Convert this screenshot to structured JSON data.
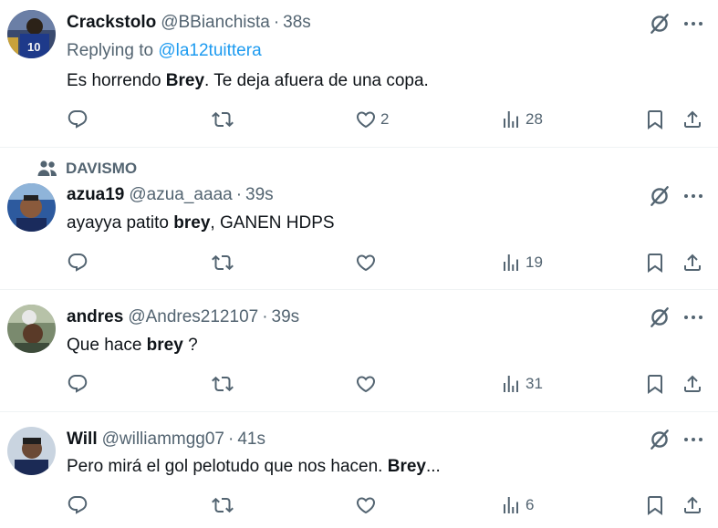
{
  "tweets": [
    {
      "name": "Crackstolo",
      "handle": "@BBianchista",
      "sep": "·",
      "time": "38s",
      "reply_prefix": "Replying to ",
      "reply_to": "@la12tuittera",
      "text_before": "Es horrendo ",
      "text_bold": "Brey",
      "text_after": ". Te deja afuera de una copa.",
      "likes": "2",
      "views": "28"
    },
    {
      "social_context": "DAVISMO",
      "name": "azua19",
      "handle": "@azua_aaaa",
      "sep": "·",
      "time": "39s",
      "text_before": "ayayya patito ",
      "text_bold": "brey",
      "text_after": ", GANEN HDPS",
      "views": "19"
    },
    {
      "name": "andres",
      "handle": "@Andres212107",
      "sep": "·",
      "time": "39s",
      "text_before": "Que hace ",
      "text_bold": "brey",
      "text_after": " ?",
      "views": "31"
    },
    {
      "name": "Will",
      "handle": "@williammgg07",
      "sep": "·",
      "time": "41s",
      "text_before": "Pero mirá el gol pelotudo que nos hacen. ",
      "text_bold": "Brey",
      "text_after": "...",
      "views": "6"
    }
  ],
  "icons": {
    "reply": "reply-icon",
    "retweet": "retweet-icon",
    "like": "heart-icon",
    "views": "views-icon",
    "bookmark": "bookmark-icon",
    "share": "share-icon",
    "grok": "grok-icon",
    "more": "more-icon"
  },
  "colors": {
    "text": "#0f1419",
    "secondary": "#536471",
    "link": "#1d9bf0",
    "divider": "#eff3f4"
  }
}
